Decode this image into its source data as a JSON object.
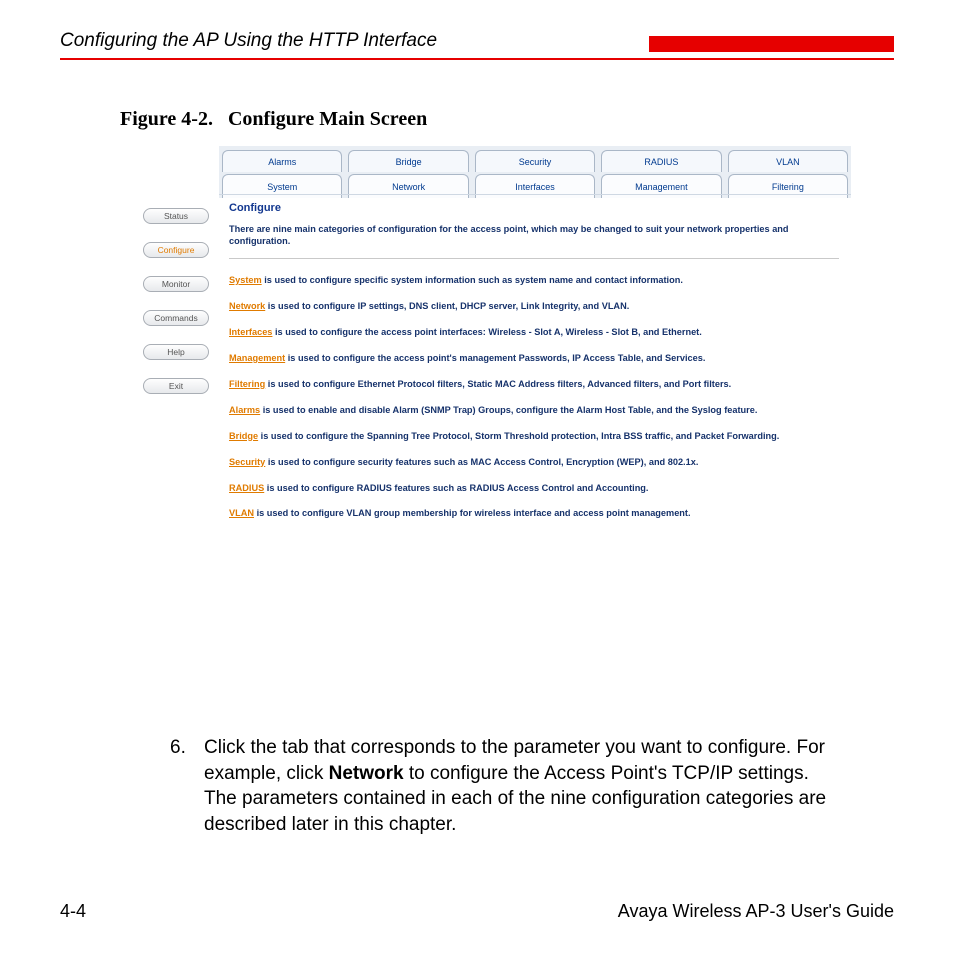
{
  "header": {
    "section_title": "Configuring the AP Using the HTTP Interface"
  },
  "figure": {
    "caption_prefix": "Figure 4-2.",
    "caption_title": "Configure Main Screen"
  },
  "screenshot": {
    "tabs_back": [
      "Alarms",
      "Bridge",
      "Security",
      "RADIUS",
      "VLAN"
    ],
    "tabs_front": [
      "System",
      "Network",
      "Interfaces",
      "Management",
      "Filtering"
    ],
    "sidebar": [
      {
        "label": "Status",
        "active": false
      },
      {
        "label": "Configure",
        "active": true
      },
      {
        "label": "Monitor",
        "active": false
      },
      {
        "label": "Commands",
        "active": false
      },
      {
        "label": "Help",
        "active": false
      },
      {
        "label": "Exit",
        "active": false
      }
    ],
    "title": "Configure",
    "intro": "There are nine main categories of configuration for the access point, which may be changed to suit your network properties and configuration.",
    "items": [
      {
        "link": "System",
        "text": " is used to configure specific system information such as system name and contact information."
      },
      {
        "link": "Network",
        "text": " is used to configure IP settings, DNS client, DHCP server, Link Integrity, and VLAN."
      },
      {
        "link": "Interfaces",
        "text": " is used to configure the access point interfaces: Wireless - Slot A, Wireless - Slot B, and Ethernet."
      },
      {
        "link": "Management",
        "text": " is used to configure the access point's management Passwords, IP Access Table, and Services."
      },
      {
        "link": "Filtering",
        "text": " is used to configure Ethernet Protocol filters, Static MAC Address filters, Advanced filters, and Port filters."
      },
      {
        "link": "Alarms",
        "text": " is used to enable and disable Alarm (SNMP Trap) Groups, configure the Alarm Host Table, and the Syslog feature."
      },
      {
        "link": "Bridge",
        "text": " is used to configure the Spanning Tree Protocol, Storm Threshold protection, Intra BSS traffic, and Packet Forwarding."
      },
      {
        "link": "Security",
        "text": " is used to configure security features such as MAC Access Control, Encryption (WEP), and 802.1x."
      },
      {
        "link": "RADIUS",
        "text": " is used to configure RADIUS features such as RADIUS Access Control and Accounting."
      },
      {
        "link": "VLAN",
        "text": " is used to configure VLAN group membership for wireless interface and access point management."
      }
    ]
  },
  "instruction": {
    "number": "6.",
    "before": "Click the tab that corresponds to the parameter you want to configure. For example, click ",
    "bold": "Network",
    "after": " to configure the Access Point's TCP/IP settings. The parameters contained in each of the nine configuration categories are described later in this chapter."
  },
  "footer": {
    "page": "4-4",
    "guide": "Avaya Wireless AP-3 User's Guide"
  }
}
